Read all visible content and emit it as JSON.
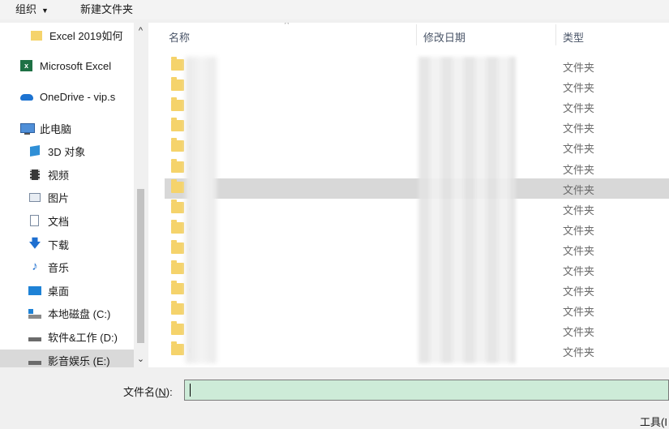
{
  "toolbar": {
    "organize": "组织",
    "new_folder": "新建文件夹"
  },
  "sidebar": {
    "items": [
      {
        "label": "Excel 2019如何",
        "icon": "folder-icon"
      },
      {
        "label": "Microsoft Excel",
        "icon": "excel-icon"
      },
      {
        "label": "OneDrive - vip.s",
        "icon": "onedrive-cloud-icon"
      },
      {
        "label": "此电脑",
        "icon": "computer-icon"
      },
      {
        "label": "3D 对象",
        "icon": "3d-objects-icon"
      },
      {
        "label": "视频",
        "icon": "video-icon"
      },
      {
        "label": "图片",
        "icon": "pictures-icon"
      },
      {
        "label": "文档",
        "icon": "documents-icon"
      },
      {
        "label": "下载",
        "icon": "download-icon"
      },
      {
        "label": "音乐",
        "icon": "music-icon"
      },
      {
        "label": "桌面",
        "icon": "desktop-icon"
      },
      {
        "label": "本地磁盘 (C:)",
        "icon": "local-disk-icon"
      },
      {
        "label": "软件&工作 (D:)",
        "icon": "drive-icon"
      },
      {
        "label": "影音娱乐 (E:)",
        "icon": "drive-icon"
      }
    ]
  },
  "columns": {
    "name": "名称",
    "modified": "修改日期",
    "type": "类型"
  },
  "files": [
    {
      "name": "",
      "type": "文件夹"
    },
    {
      "name": "",
      "type": "文件夹"
    },
    {
      "name": "",
      "type": "文件夹"
    },
    {
      "name": "c",
      "type": "文件夹"
    },
    {
      "name": "c",
      "type": "文件夹"
    },
    {
      "name": "c",
      "type": "文件夹"
    },
    {
      "name": "c",
      "type": "文件夹"
    },
    {
      "name": "c.",
      "type": "文件夹"
    },
    {
      "name": "cl",
      "type": "文件夹"
    },
    {
      "name": "c",
      "type": "文件夹"
    },
    {
      "name": "c",
      "type": "文件夹"
    },
    {
      "name": "c",
      "type": "文件夹"
    },
    {
      "name": "",
      "type": "文件夹"
    },
    {
      "name": "",
      "type": "文件夹"
    },
    {
      "name": "c.",
      "type": "文件夹"
    }
  ],
  "footer": {
    "filename_label": "文件名(",
    "filename_hotkey": "N",
    "filename_label_end": "):",
    "filename_value": "",
    "tools": "工具(I"
  }
}
